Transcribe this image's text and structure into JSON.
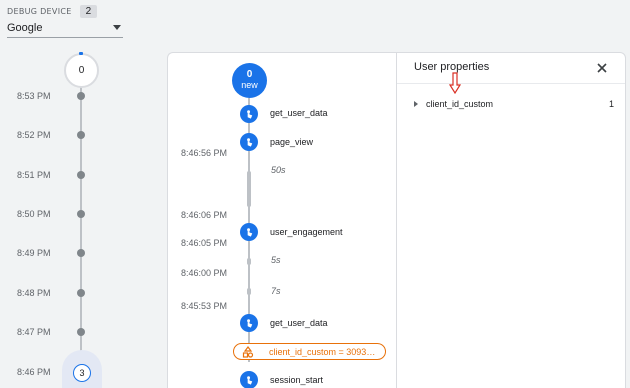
{
  "debug_device": {
    "label": "DEBUG DEVICE",
    "count": "2",
    "selected": "Google"
  },
  "minutes": {
    "top_count": "0",
    "times": [
      "8:53 PM",
      "8:52 PM",
      "8:51 PM",
      "8:50 PM",
      "8:49 PM",
      "8:48 PM",
      "8:47 PM",
      "8:46 PM"
    ],
    "selected_count": "3"
  },
  "stream": {
    "new_count": "0",
    "new_label": "new",
    "events": {
      "get_user_data_1": "get_user_data",
      "page_view": "page_view",
      "user_engagement": "user_engagement",
      "get_user_data_2": "get_user_data",
      "session_start": "session_start"
    },
    "times": [
      "8:46:56 PM",
      "8:46:06 PM",
      "8:46:05 PM",
      "8:46:00 PM",
      "8:45:53 PM"
    ],
    "gaps": [
      "50s",
      "5s",
      "7s"
    ],
    "property_chip": "client_id_custom = 3093…"
  },
  "user_properties": {
    "title": "User properties",
    "items": [
      {
        "name": "client_id_custom",
        "value": "1"
      }
    ]
  },
  "colors": {
    "accent": "#1a73e8",
    "property": "#e8710a",
    "annotation": "#d93025"
  },
  "icons": [
    "caret-down-icon",
    "event-touch-icon",
    "property-shapes-icon",
    "close-icon",
    "expand-triangle-icon",
    "red-arrow-annotation"
  ]
}
